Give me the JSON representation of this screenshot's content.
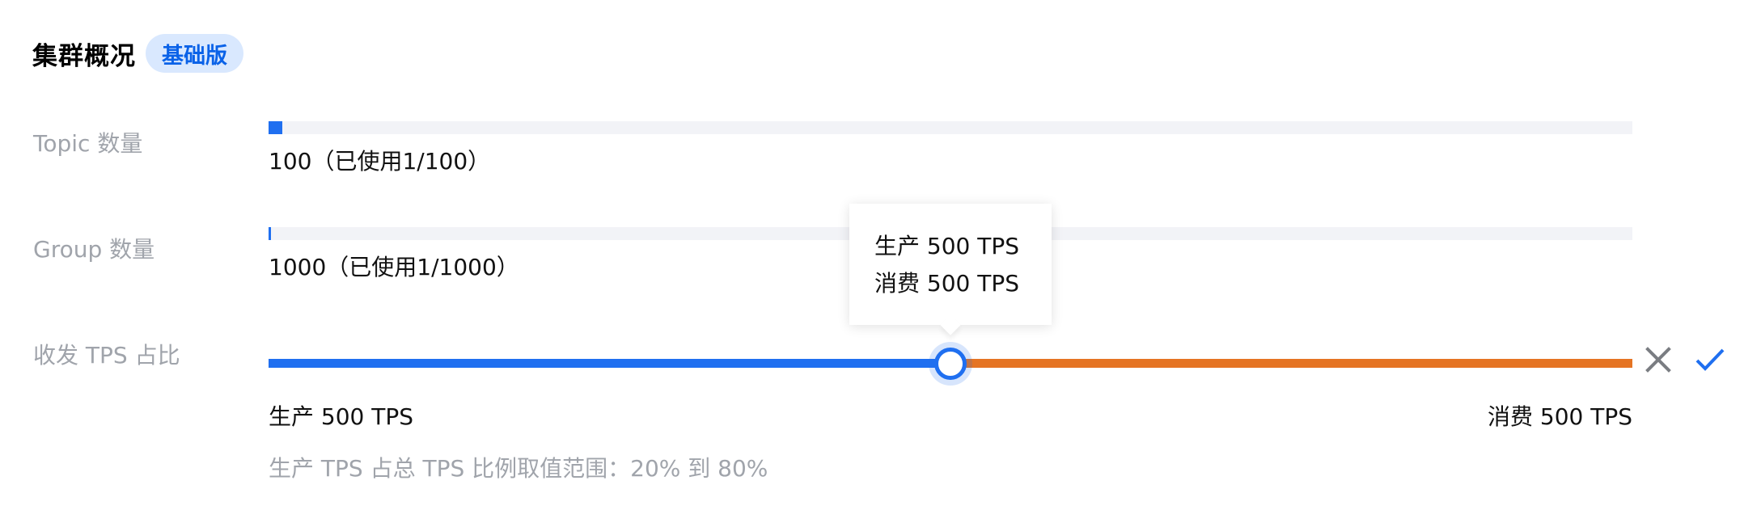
{
  "header": {
    "title": "集群概况",
    "badge": "基础版"
  },
  "topic": {
    "label": "Topic 数量",
    "usage_text": "100（已使用1/100）",
    "used": 1,
    "total": 100
  },
  "group": {
    "label": "Group 数量",
    "usage_text": "1000（已使用1/1000）",
    "used": 1,
    "total": 1000
  },
  "tps": {
    "label": "收发 TPS 占比",
    "produce_fraction": 0.5,
    "tooltip_produce": "生产 500 TPS",
    "tooltip_consume": "消费 500 TPS",
    "produce_label": "生产 500 TPS",
    "consume_label": "消费 500 TPS",
    "hint": "生产 TPS 占总 TPS 比例取值范围：20% 到 80%"
  },
  "icons": {
    "cancel": "close-icon",
    "confirm": "check-icon"
  },
  "colors": {
    "primary": "#1f6ff0",
    "consume": "#e57423",
    "badge_bg": "#d9e8fe",
    "badge_text": "#0a62e8",
    "muted": "#a0a4ab"
  }
}
